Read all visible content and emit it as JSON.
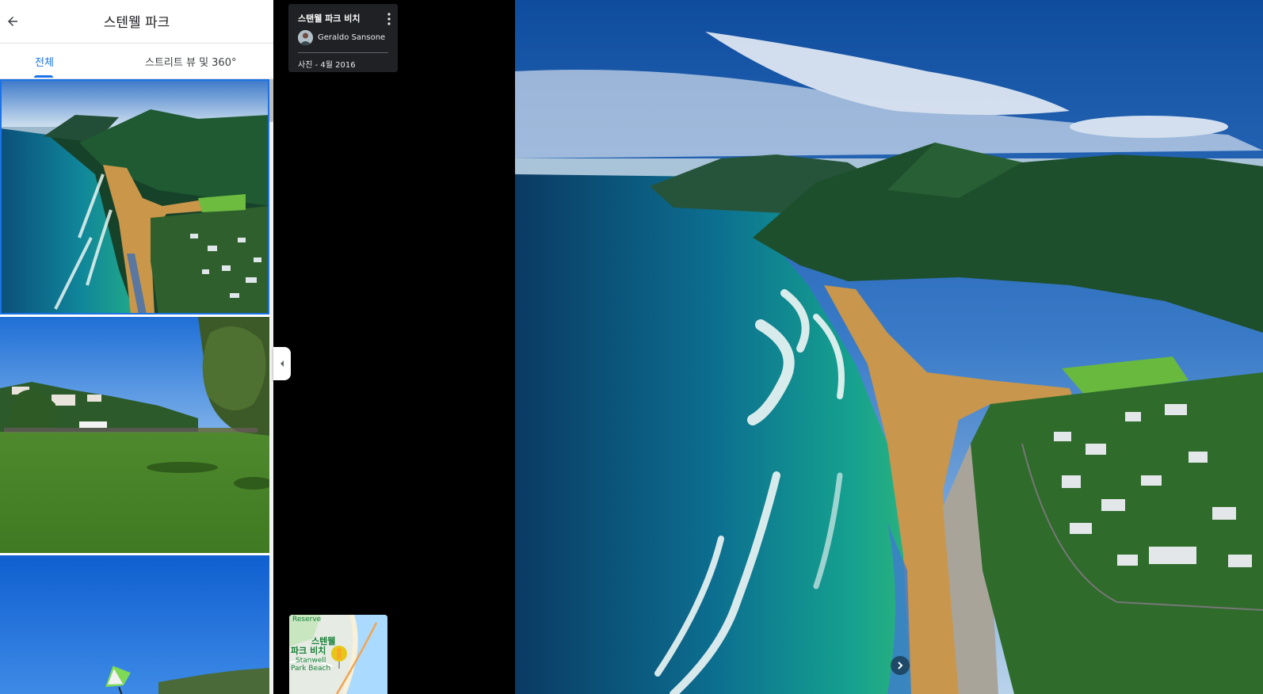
{
  "place": {
    "title": "스텐웰 파크"
  },
  "tabs": [
    {
      "label": "전체",
      "active": true
    },
    {
      "label": "스트리트 뷰 및 360°",
      "active": false
    }
  ],
  "photo_info": {
    "title": "스탠웰 파크 비치",
    "author": "Geraldo Sansone",
    "date": "사진 - 4월 2016"
  },
  "minimap": {
    "top_label": "Reserve",
    "place_label_line1": "스텐웰",
    "place_label_line2": "파크 비치",
    "en_label_line1": "Stanwell",
    "en_label_line2": "Park Beach"
  },
  "thumbnails": [
    {
      "subject": "aerial-coast",
      "selected": true
    },
    {
      "subject": "park-field"
    },
    {
      "subject": "hang-glider"
    }
  ],
  "icons": {
    "back": "arrow-left-icon",
    "more": "more-vert-icon",
    "collapse": "chevron-left-icon",
    "next": "chevron-right-icon",
    "pin": "pegman-pin-icon"
  },
  "colors": {
    "accent": "#1a73e8",
    "card_bg": "#202124"
  }
}
